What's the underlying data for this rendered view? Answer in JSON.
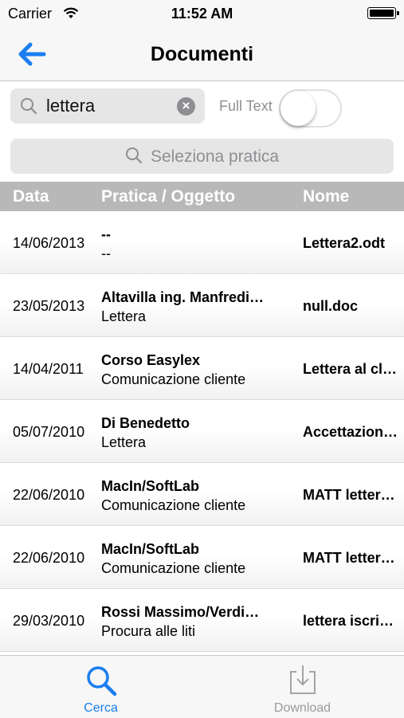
{
  "status_bar": {
    "carrier": "Carrier",
    "time": "11:52 AM"
  },
  "nav": {
    "title": "Documenti"
  },
  "search": {
    "query": "lettera",
    "fulltext_label": "Full Text",
    "fulltext_on": false
  },
  "select_pratica": {
    "placeholder": "Seleziona pratica"
  },
  "table": {
    "headers": {
      "date": "Data",
      "pratica": "Pratica / Oggetto",
      "nome": "Nome"
    },
    "rows": [
      {
        "date": "14/06/2013",
        "pratica": "--",
        "oggetto": "--",
        "nome": "Lettera2.odt"
      },
      {
        "date": "23/05/2013",
        "pratica": "Altavilla ing. Manfredi…",
        "oggetto": "Lettera",
        "nome": "null.doc"
      },
      {
        "date": "14/04/2011",
        "pratica": "Corso Easylex",
        "oggetto": "Comunicazione cliente",
        "nome": "Lettera al cl…"
      },
      {
        "date": "05/07/2010",
        "pratica": "Di Benedetto",
        "oggetto": "Lettera",
        "nome": "Accettazion…"
      },
      {
        "date": "22/06/2010",
        "pratica": "MacIn/SoftLab",
        "oggetto": "Comunicazione cliente",
        "nome": "MATT letter…"
      },
      {
        "date": "22/06/2010",
        "pratica": "MacIn/SoftLab",
        "oggetto": "Comunicazione cliente",
        "nome": "MATT letter…"
      },
      {
        "date": "29/03/2010",
        "pratica": "Rossi Massimo/Verdi…",
        "oggetto": "Procura alle liti",
        "nome": "lettera iscri…"
      }
    ]
  },
  "tabbar": {
    "tabs": [
      {
        "label": "Cerca",
        "icon": "search-icon",
        "active": true
      },
      {
        "label": "Download",
        "icon": "download-icon",
        "active": false
      }
    ]
  },
  "colors": {
    "accent": "#1a7ef0",
    "header_bg": "#b8b8b8",
    "field_bg": "#e6e6e6"
  }
}
